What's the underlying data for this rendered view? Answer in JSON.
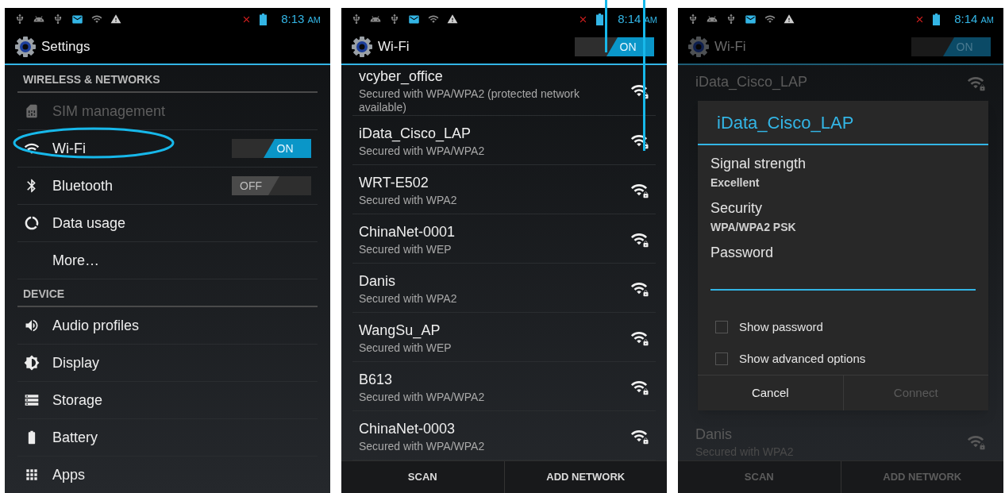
{
  "screens": [
    {
      "kind": "settings",
      "status": {
        "time": "8:13",
        "meridiem": "AM"
      },
      "title": "Settings",
      "sections": [
        {
          "header": "WIRELESS & NETWORKS",
          "items": [
            {
              "label": "SIM management",
              "disabled": true
            },
            {
              "label": "Wi-Fi",
              "disabled": false,
              "toggle": {
                "label": "ON",
                "on": true
              }
            },
            {
              "label": "Bluetooth",
              "disabled": false,
              "toggle": {
                "label": "OFF",
                "on": false
              }
            },
            {
              "label": "Data usage",
              "disabled": false
            },
            {
              "label": "More…",
              "disabled": false
            }
          ]
        },
        {
          "header": "DEVICE",
          "items": [
            {
              "label": "Audio profiles",
              "disabled": false
            },
            {
              "label": "Display",
              "disabled": false
            },
            {
              "label": "Storage",
              "disabled": false
            },
            {
              "label": "Battery",
              "disabled": false
            },
            {
              "label": "Apps",
              "disabled": false
            }
          ]
        }
      ]
    },
    {
      "kind": "wifi_list",
      "status": {
        "time": "8:14",
        "meridiem": "AM"
      },
      "title": "Wi-Fi",
      "toggle": {
        "label": "ON",
        "on": true
      },
      "networks": [
        {
          "name": "vcyber_office",
          "security": "Secured with WPA/WPA2 (protected network available)"
        },
        {
          "name": "iData_Cisco_LAP",
          "security": "Secured with WPA/WPA2"
        },
        {
          "name": "WRT-E502",
          "security": "Secured with WPA2"
        },
        {
          "name": "ChinaNet-0001",
          "security": "Secured with WEP"
        },
        {
          "name": "Danis",
          "security": "Secured with WPA2"
        },
        {
          "name": "WangSu_AP",
          "security": "Secured with WEP"
        },
        {
          "name": "B613",
          "security": "Secured with WPA/WPA2"
        },
        {
          "name": "ChinaNet-0003",
          "security": "Secured with WPA/WPA2"
        }
      ],
      "buttons": [
        "SCAN",
        "ADD NETWORK"
      ]
    },
    {
      "kind": "wifi_dialog",
      "status": {
        "time": "8:14",
        "meridiem": "AM"
      },
      "title": "Wi-Fi",
      "toggle": {
        "label": "ON",
        "on": true
      },
      "top_network": {
        "name": "iData_Cisco_LAP"
      },
      "bottom_network": {
        "name": "Danis",
        "security": "Secured with WPA2"
      },
      "dialog": {
        "title": "iData_Cisco_LAP",
        "fields": [
          {
            "label": "Signal strength",
            "value": "Excellent"
          },
          {
            "label": "Security",
            "value": "WPA/WPA2 PSK"
          }
        ],
        "password": {
          "label": "Password"
        },
        "options": [
          {
            "label": "Show password",
            "checked": false
          },
          {
            "label": "Show advanced options",
            "checked": false
          }
        ],
        "buttons": [
          {
            "label": "Cancel",
            "disabled": false
          },
          {
            "label": "Connect",
            "disabled": true
          }
        ]
      },
      "buttons": [
        "SCAN",
        "ADD NETWORK"
      ]
    }
  ]
}
